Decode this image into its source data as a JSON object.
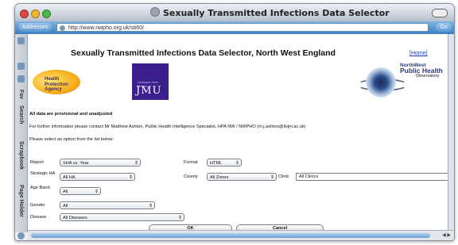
{
  "window": {
    "title": "Sexually Transmitted Infections Data Selector",
    "toolbar_left": "Addresses",
    "url": "http://www.nwpho.org.uk/sti60/",
    "go_label": "Go"
  },
  "sidebar": {
    "tabs": [
      "Fav",
      "Search",
      "Scrapbook",
      "Page Holder"
    ]
  },
  "page": {
    "title": "Sexually Transmitted Infections Data Selector, North West England",
    "home_link": "[Home]",
    "logos": {
      "hpa": [
        "Health",
        "Protection",
        "Agency"
      ],
      "jmu": "JMU",
      "jmu_sub": "Liverpool John Moores",
      "nwpho": [
        "NorthWest",
        "Public Health",
        "Observatory"
      ]
    },
    "notice": "All data are provisional and unadjusted",
    "contact": "For further information please contact Mr Matthew Ashton, Public Health Intelligence Specialist, HPA NW / NWPHO (m.j.ashton@livjm.ac.uk)",
    "instruction": "Please select an option from the list below:"
  },
  "form": {
    "report": {
      "label": "Report",
      "value": "SHA vs. Year"
    },
    "format": {
      "label": "Format",
      "value": "HTML"
    },
    "strategic_ha": {
      "label": "Strategic HA",
      "value": "All HA"
    },
    "county": {
      "label": "County",
      "value": "All Zones"
    },
    "clinic": {
      "label": "Clinic",
      "value": "All Clinics"
    },
    "age_band": {
      "label": "Age Band",
      "value": "All"
    },
    "gender": {
      "label": "Gender",
      "value": "All"
    },
    "disease": {
      "label": "Disease",
      "value": "All Diseases"
    },
    "ok_label": "OK",
    "cancel_label": "Cancel"
  },
  "colors": {
    "toolbar_blue": "#3c7ec2",
    "link_blue": "#1a3fb8",
    "jmu_purple": "#3b1f8c",
    "hpa_orange": "#f5b321",
    "close_red": "#e0443a",
    "minimize_yellow": "#f1b52e",
    "zoom_green": "#4cb744"
  }
}
